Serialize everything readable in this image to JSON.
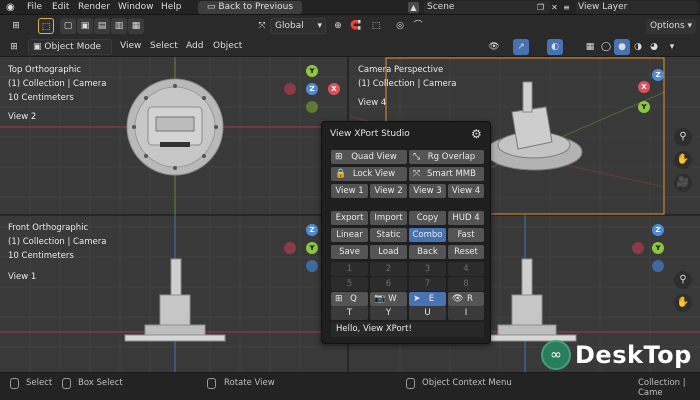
{
  "topbar": {
    "menu": [
      "File",
      "Edit",
      "Render",
      "Window",
      "Help"
    ],
    "back_button": "Back to Previous",
    "scene": "Scene",
    "view_layer": "View Layer"
  },
  "toolbar": {
    "orientation": "Global",
    "options": "Options"
  },
  "header": {
    "mode": "Object Mode",
    "menu": [
      "View",
      "Select",
      "Add",
      "Object"
    ]
  },
  "viewports": {
    "top_left": {
      "title": "Top Orthographic",
      "collection": "(1) Collection | Camera",
      "scale": "10 Centimeters",
      "view": "View 2"
    },
    "top_right": {
      "title": "Camera Perspective",
      "collection": "(1) Collection | Camera",
      "view": "View 4"
    },
    "bottom_left": {
      "title": "Front Orthographic",
      "collection": "(1) Collection | Camera",
      "scale": "10 Centimeters",
      "view": "View 1"
    }
  },
  "gizmo_axes": {
    "x": "X",
    "y": "Y",
    "z": "Z"
  },
  "panel": {
    "title": "View XPort Studio",
    "row1": [
      "Quad View",
      "Rg Overlap"
    ],
    "row2": [
      "Lock View",
      "Smart MMB"
    ],
    "views": [
      "View 1",
      "View 2",
      "View 3",
      "View 4"
    ],
    "actions": [
      "Export",
      "Import",
      "Copy",
      "HUD 4"
    ],
    "interp": [
      "Linear",
      "Static",
      "Combo",
      "Fast"
    ],
    "slots": [
      "Save",
      "Load",
      "Back",
      "Reset"
    ],
    "numbers_row1": [
      "1",
      "2",
      "3",
      "4"
    ],
    "numbers_row2": [
      "5",
      "6",
      "7",
      "8"
    ],
    "keys_row1": [
      "Q",
      "W",
      "E",
      "R"
    ],
    "keys_row2": [
      "T",
      "Y",
      "U",
      "I"
    ],
    "message": "Hello, View XPort!"
  },
  "statusbar": {
    "select": "Select",
    "box_select": "Box Select",
    "rotate": "Rotate View",
    "context": "Object Context Menu",
    "collection": "Collection | Came"
  },
  "watermark": {
    "text": "DeskTop"
  },
  "colors": {
    "accent": "#4772b3",
    "x_axis": "#e0505a",
    "y_axis": "#8dc63f",
    "z_axis": "#4c8cd8",
    "selection_outline": "#e8902a"
  }
}
